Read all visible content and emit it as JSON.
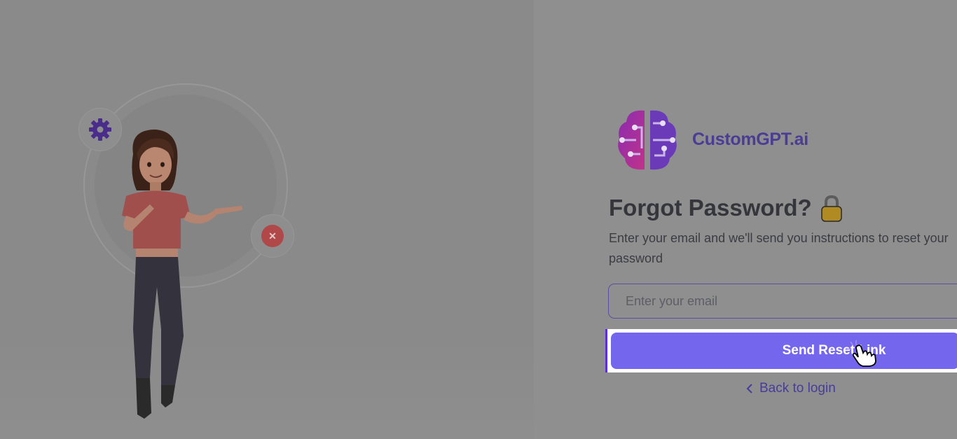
{
  "brand": {
    "name": "CustomGPT.ai",
    "logo_icon": "brain-circuit-icon",
    "accent": "#7467ee",
    "brand_text_color": "#4b3c95"
  },
  "illustration": {
    "character": "cartoon-woman-presenting",
    "gear_icon": "gear-icon",
    "close_icon": "close-icon"
  },
  "form": {
    "title": "Forgot Password?",
    "title_icon": "lock-icon",
    "subtitle": "Enter your email and we'll send you instructions to reset your password",
    "email_placeholder": "Enter your email",
    "email_value": "",
    "submit_label": "Send Reset Link",
    "back_label": "Back to login"
  }
}
